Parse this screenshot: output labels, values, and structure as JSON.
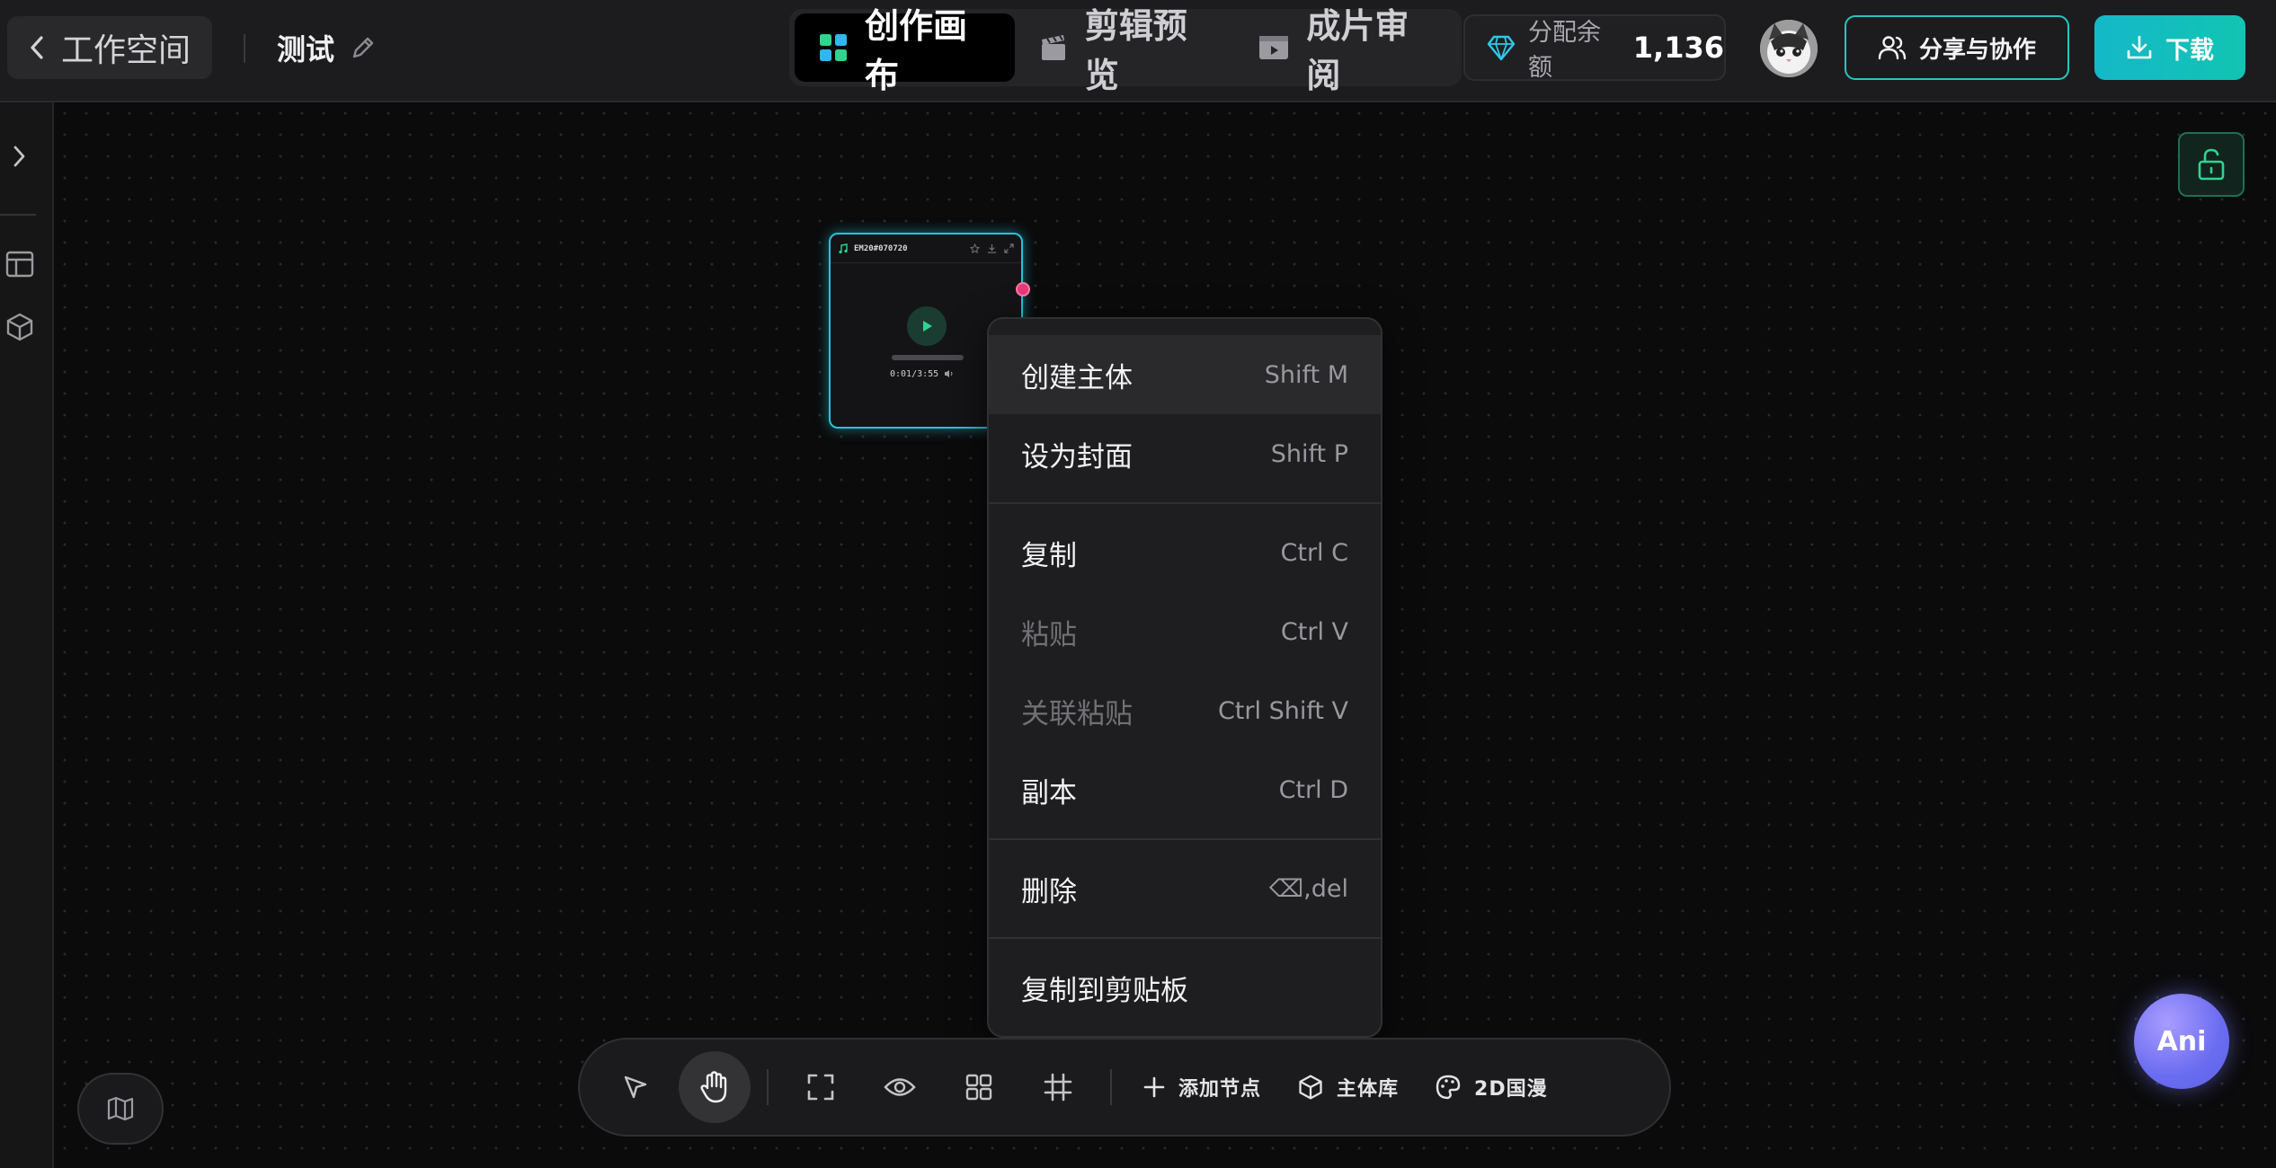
{
  "header": {
    "back_label": "工作空间",
    "project_name": "测试",
    "tabs": [
      {
        "label": "创作画布"
      },
      {
        "label": "剪辑预览"
      },
      {
        "label": "成片审阅"
      }
    ],
    "balance_label": "分配余额",
    "balance_value": "1,136",
    "share_label": "分享与协作",
    "download_label": "下载"
  },
  "node": {
    "title": "EM20#070720",
    "time": "0:01/3:55",
    "progress": 0.04
  },
  "context_menu": {
    "items": [
      {
        "label": "创建主体",
        "shortcut": "Shift M"
      },
      {
        "label": "设为封面",
        "shortcut": "Shift P"
      },
      {
        "label": "复制",
        "shortcut": "Ctrl C"
      },
      {
        "label": "粘贴",
        "shortcut": "Ctrl V"
      },
      {
        "label": "关联粘贴",
        "shortcut": "Ctrl Shift V"
      },
      {
        "label": "副本",
        "shortcut": "Ctrl D"
      },
      {
        "label": "删除",
        "shortcut": "⌫,del"
      },
      {
        "label": "复制到剪贴板",
        "shortcut": ""
      }
    ]
  },
  "toolbar": {
    "add_node_label": "添加节点",
    "subject_library_label": "主体库",
    "style_label": "2D国漫"
  },
  "assistant": {
    "label": "Ani"
  },
  "colors": {
    "accent": "#26c6c1",
    "node_border": "#27c4d8",
    "lock_green": "#2fd58f",
    "port": "#e6397a"
  }
}
